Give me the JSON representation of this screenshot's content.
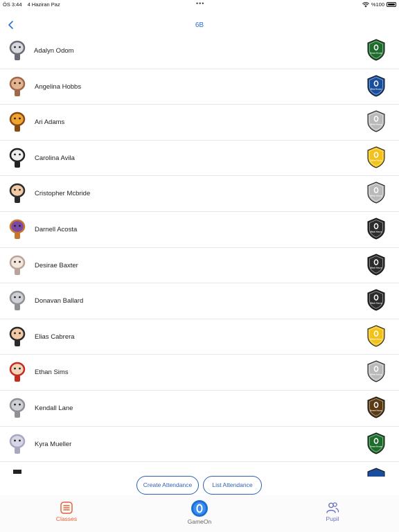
{
  "status_bar": {
    "time": "ÖS 3:44",
    "date": "4 Haziran Paz",
    "battery": "%100"
  },
  "nav": {
    "title": "6B"
  },
  "pupils": [
    {
      "name": "Adalyn Odom",
      "avatar": "raccoon-avatar",
      "house": "Green House",
      "house_color": "#1e6b2c"
    },
    {
      "name": "Angelina Hobbs",
      "avatar": "bear-avatar",
      "house": "Blue House",
      "house_color": "#1a4d9c"
    },
    {
      "name": "Ari Adams",
      "avatar": "lion-avatar",
      "house": "White House",
      "house_color": "#b9b9b9"
    },
    {
      "name": "Carolina Avila",
      "avatar": "car-avatar",
      "house": "Yellow House",
      "house_color": "#f2c21b"
    },
    {
      "name": "Cristopher Mcbride",
      "avatar": "soldier-avatar",
      "house": "White House",
      "house_color": "#b9b9b9"
    },
    {
      "name": "Darnell Acosta",
      "avatar": "fox-basketball-avatar",
      "house": "Black House",
      "house_color": "#2b2b2b"
    },
    {
      "name": "Desirae Baxter",
      "avatar": "bunny-avatar",
      "house": "Black House",
      "house_color": "#2b2b2b"
    },
    {
      "name": "Donavan Ballard",
      "avatar": "cat-avatar",
      "house": "Black House",
      "house_color": "#2b2b2b"
    },
    {
      "name": "Elias Cabrera",
      "avatar": "soldier-avatar",
      "house": "Yellow House",
      "house_color": "#f2c21b"
    },
    {
      "name": "Ethan Sims",
      "avatar": "devil-avatar",
      "house": "White House",
      "house_color": "#b9b9b9"
    },
    {
      "name": "Kendall Lane",
      "avatar": "cat-avatar",
      "house": "Brown House",
      "house_color": "#5a3a12"
    },
    {
      "name": "Kyra Mueller",
      "avatar": "elephant-avatar",
      "house": "Green House",
      "house_color": "#1e6b2c"
    }
  ],
  "attendance": {
    "create_label": "Create Attendance",
    "list_label": "List Attendance"
  },
  "tabs": {
    "classes": "Classes",
    "gameon": "GameOn",
    "pupil": "Pupil"
  },
  "colors": {
    "accent": "#2a6fd6",
    "classes_active": "#e8603a",
    "pupil_tab": "#6b6fc4"
  }
}
